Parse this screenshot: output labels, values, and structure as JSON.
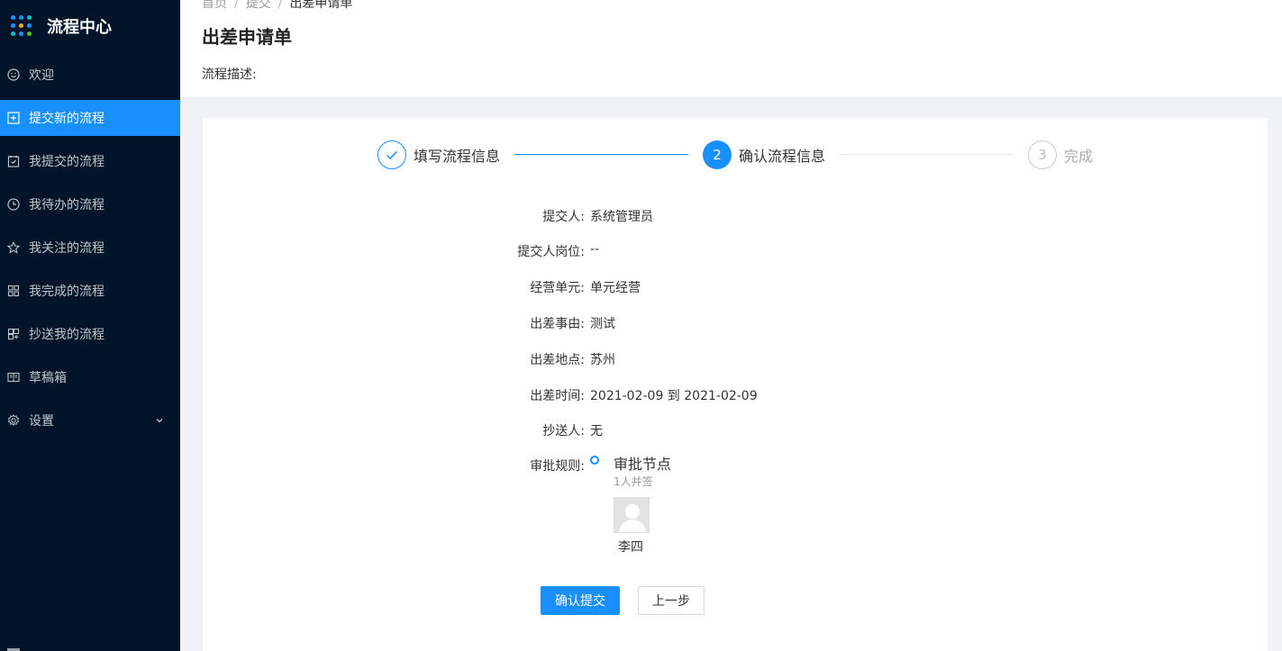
{
  "app": {
    "title": "流程中心"
  },
  "sidebar": {
    "items": [
      {
        "label": "欢迎",
        "icon": "smile-icon"
      },
      {
        "label": "提交新的流程",
        "icon": "plus-square-icon",
        "active": true
      },
      {
        "label": "我提交的流程",
        "icon": "check-square-icon"
      },
      {
        "label": "我待办的流程",
        "icon": "clock-icon"
      },
      {
        "label": "我关注的流程",
        "icon": "star-icon"
      },
      {
        "label": "我完成的流程",
        "icon": "appstore-icon"
      },
      {
        "label": "抄送我的流程",
        "icon": "copy-icon"
      },
      {
        "label": "草稿箱",
        "icon": "book-icon"
      },
      {
        "label": "设置",
        "icon": "gear-icon"
      }
    ]
  },
  "breadcrumb": {
    "items": [
      "首页",
      "提交",
      "出差申请单"
    ]
  },
  "page": {
    "title": "出差申请单",
    "description": "流程描述:"
  },
  "steps": [
    {
      "title": "填写流程信息",
      "status": "finished"
    },
    {
      "title": "确认流程信息",
      "number": "2",
      "status": "current"
    },
    {
      "title": "完成",
      "number": "3",
      "status": "waiting"
    }
  ],
  "form": {
    "submitter_label": "提交人:",
    "submitter": "系统管理员",
    "position_label": "提交人岗位:",
    "position": "--",
    "unit_label": "经营单元:",
    "unit": "单元经营",
    "reason_label": "出差事由:",
    "reason": "测试",
    "place_label": "出差地点:",
    "place": "苏州",
    "time_label": "出差时间:",
    "time": "2021-02-09 到 2021-02-09",
    "cc_label": "抄送人:",
    "cc": "无",
    "rule_label": "审批规则:"
  },
  "approval": {
    "node_title": "审批节点",
    "node_type": "1人并签",
    "approver": "李四"
  },
  "buttons": {
    "confirm": "确认提交",
    "prev": "上一步"
  },
  "colors": {
    "sidebar_bg": "#001529",
    "primary": "#1890ff"
  }
}
